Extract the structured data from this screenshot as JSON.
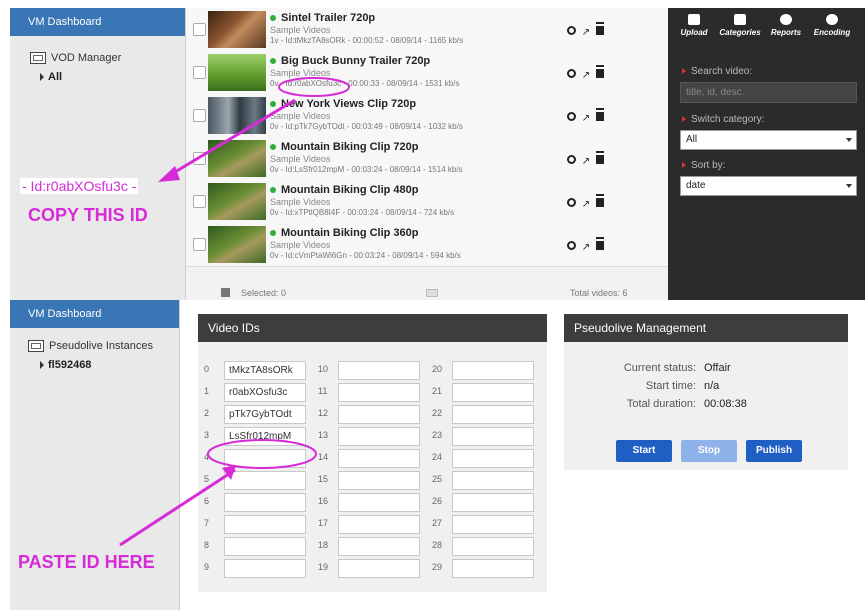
{
  "top": {
    "sidebar": {
      "title": "VM Dashboard",
      "manager": "VOD Manager",
      "sub": "All"
    },
    "videos": [
      {
        "title": "Sintel Trailer 720p",
        "category": "Sample Videos",
        "meta": "1v - Id:tMkzTA8sORk - 00:00:52 - 08/09/14 - 1165 kb/s",
        "thumb": "thumb-a"
      },
      {
        "title": "Big Buck Bunny Trailer 720p",
        "category": "Sample Videos",
        "meta": "0v - Id:r0abXOsfu3c - 00:00:33 - 08/09/14 - 1531 kb/s",
        "thumb": "thumb-b"
      },
      {
        "title": "New York Views Clip 720p",
        "category": "Sample Videos",
        "meta": "0v - Id:pTk7GybTOdt - 00:03:49 - 08/09/14 - 1032 kb/s",
        "thumb": "thumb-c"
      },
      {
        "title": "Mountain Biking Clip 720p",
        "category": "Sample Videos",
        "meta": "0v - Id:LsSfr012mpM - 00:03:24 - 08/09/14 - 1514 kb/s",
        "thumb": "thumb-d"
      },
      {
        "title": "Mountain Biking Clip 480p",
        "category": "Sample Videos",
        "meta": "0v - Id:xTPtlQB8I4F - 00:03:24 - 08/09/14 - 724 kb/s",
        "thumb": "thumb-d"
      },
      {
        "title": "Mountain Biking Clip 360p",
        "category": "Sample Videos",
        "meta": "0v - Id:cVmPtaWi6Gn - 00:03:24 - 08/09/14 - 594 kb/s",
        "thumb": "thumb-d"
      }
    ],
    "footer": {
      "selected": "Selected: 0",
      "total": "Total videos: 6"
    },
    "toolbar": {
      "upload": "Upload",
      "categories": "Categories",
      "reports": "Reports",
      "encoding": "Encoding"
    },
    "search": {
      "label": "Search video:",
      "placeholder": "title, id, desc."
    },
    "category": {
      "label": "Switch category:",
      "value": "All"
    },
    "sort": {
      "label": "Sort by:",
      "value": "date"
    }
  },
  "annotations": {
    "copy_id": "- Id:r0abXOsfu3c -",
    "copy_text": "COPY THIS ID",
    "paste_text": "PASTE ID HERE",
    "color": "#d62bd6"
  },
  "bottom": {
    "sidebar": {
      "title": "VM Dashboard",
      "instances": "Pseudolive Instances",
      "sub": "fl592468"
    },
    "video_ids": {
      "title": "Video IDs",
      "slots": [
        {
          "n": "0",
          "v": "tMkzTA8sORk"
        },
        {
          "n": "1",
          "v": "r0abXOsfu3c"
        },
        {
          "n": "2",
          "v": "pTk7GybTOdt"
        },
        {
          "n": "3",
          "v": "LsSfr012mpM"
        },
        {
          "n": "4",
          "v": ""
        },
        {
          "n": "5",
          "v": ""
        },
        {
          "n": "6",
          "v": ""
        },
        {
          "n": "7",
          "v": ""
        },
        {
          "n": "8",
          "v": ""
        },
        {
          "n": "9",
          "v": ""
        },
        {
          "n": "10",
          "v": ""
        },
        {
          "n": "11",
          "v": ""
        },
        {
          "n": "12",
          "v": ""
        },
        {
          "n": "13",
          "v": ""
        },
        {
          "n": "14",
          "v": ""
        },
        {
          "n": "15",
          "v": ""
        },
        {
          "n": "16",
          "v": ""
        },
        {
          "n": "17",
          "v": ""
        },
        {
          "n": "18",
          "v": ""
        },
        {
          "n": "19",
          "v": ""
        },
        {
          "n": "20",
          "v": ""
        },
        {
          "n": "21",
          "v": ""
        },
        {
          "n": "22",
          "v": ""
        },
        {
          "n": "23",
          "v": ""
        },
        {
          "n": "24",
          "v": ""
        },
        {
          "n": "25",
          "v": ""
        },
        {
          "n": "26",
          "v": ""
        },
        {
          "n": "27",
          "v": ""
        },
        {
          "n": "28",
          "v": ""
        },
        {
          "n": "29",
          "v": ""
        }
      ]
    },
    "pseudolive": {
      "title": "Pseudolive Management",
      "status_label": "Current status:",
      "status": "Offair",
      "start_label": "Start time:",
      "start": "n/a",
      "duration_label": "Total duration:",
      "duration": "00:08:38",
      "start_btn": "Start",
      "stop_btn": "Stop",
      "publish_btn": "Publish",
      "btn_color": "#1f5fc4",
      "btn_disabled_color": "#8fb3e8"
    }
  }
}
